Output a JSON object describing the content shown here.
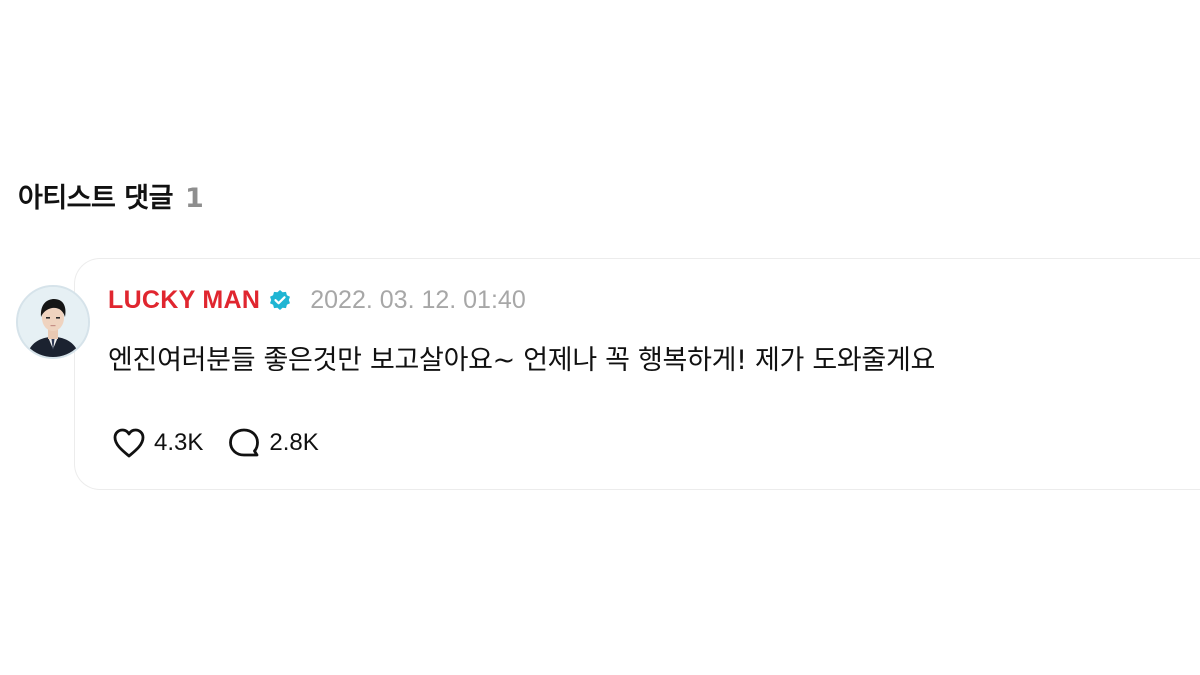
{
  "section": {
    "title": "아티스트 댓글",
    "count": "1"
  },
  "comment": {
    "author": "LUCKY MAN",
    "verified": true,
    "timestamp": "2022. 03. 12. 01:40",
    "text": "엔진여러분들 좋은것만 보고살아요~ 언제나 꼭 행복하게! 제가 도와줄게요",
    "likes": "4.3K",
    "replies": "2.8K"
  },
  "colors": {
    "author": "#e0262f",
    "verified_badge": "#1fb5d3",
    "timestamp": "#a7a7a7",
    "count": "#8e8e8e"
  },
  "icons": {
    "avatar": "user-avatar-photo",
    "verified": "verified-badge-icon",
    "like": "heart-icon",
    "reply": "speech-bubble-icon"
  }
}
